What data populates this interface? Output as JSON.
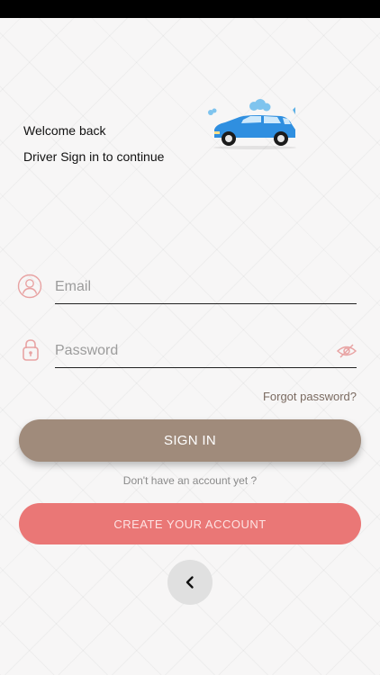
{
  "header": {
    "welcome": "Welcome back",
    "subtitle": "Driver Sign in to continue"
  },
  "form": {
    "email": {
      "placeholder": "Email",
      "value": ""
    },
    "password": {
      "placeholder": "Password",
      "value": ""
    },
    "forgot_label": "Forgot password?"
  },
  "actions": {
    "signin_label": "SIGN IN",
    "no_account_text": "Don't have an account yet ?",
    "create_label": "CREATE YOUR ACCOUNT"
  },
  "icons": {
    "car": "car-icon",
    "user": "user-icon",
    "lock": "lock-icon",
    "eye": "eye-off-icon",
    "back": "chevron-left-icon"
  },
  "colors": {
    "signin": "#a08b7b",
    "create": "#ea7776",
    "icon_accent": "#e8a3a3",
    "car": "#2f8fe0"
  }
}
